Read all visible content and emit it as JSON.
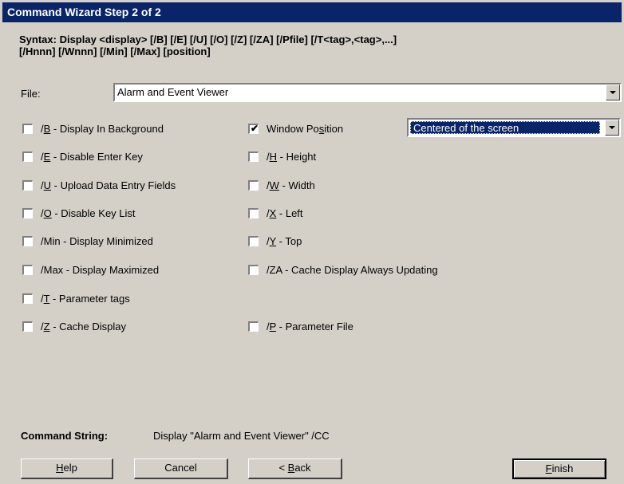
{
  "window": {
    "title": "Command Wizard Step 2 of 2"
  },
  "syntax": {
    "line1": "Syntax: Display <display> [/B] [/E] [/U] [/O] [/Z] [/ZA] [/Pfile] [/T<tag>,<tag>,...]",
    "line2": "[/Hnnn] [/Wnnn] [/Min] [/Max] [position]"
  },
  "file": {
    "label": "File:",
    "value": "Alarm and Event Viewer"
  },
  "position_select": {
    "value": "Centered of the screen"
  },
  "left_options": [
    {
      "prefix": "/",
      "mnemonic": "B",
      "suffix": " - Display In Background",
      "checked": false
    },
    {
      "prefix": "/",
      "mnemonic": "E",
      "suffix": " - Disable Enter Key",
      "checked": false
    },
    {
      "prefix": "/",
      "mnemonic": "U",
      "suffix": " - Upload Data Entry Fields",
      "checked": false
    },
    {
      "prefix": "/",
      "mnemonic": "O",
      "suffix": " - Disable Key List",
      "checked": false
    },
    {
      "prefix": "/Min - Display Minimized",
      "mnemonic": "",
      "suffix": "",
      "checked": false
    },
    {
      "prefix": "/Max - Display Maximized",
      "mnemonic": "",
      "suffix": "",
      "checked": false
    },
    {
      "prefix": "/",
      "mnemonic": "T",
      "suffix": " - Parameter tags",
      "checked": false
    },
    {
      "prefix": "/",
      "mnemonic": "Z",
      "suffix": " - Cache Display",
      "checked": false
    }
  ],
  "right_options": [
    {
      "prefix": "Window Po",
      "mnemonic": "s",
      "suffix": "ition",
      "checked": true
    },
    {
      "prefix": "/",
      "mnemonic": "H",
      "suffix": " - Height",
      "checked": false
    },
    {
      "prefix": "/",
      "mnemonic": "W",
      "suffix": " - Width",
      "checked": false
    },
    {
      "prefix": "/",
      "mnemonic": "X",
      "suffix": " - Left",
      "checked": false
    },
    {
      "prefix": "/",
      "mnemonic": "Y",
      "suffix": " - Top",
      "checked": false
    },
    {
      "prefix": "/ZA - Cache Display Always Updating",
      "mnemonic": "",
      "suffix": "",
      "checked": false
    },
    {
      "prefix": "/",
      "mnemonic": "P",
      "suffix": " - Parameter File",
      "checked": false
    }
  ],
  "command": {
    "label": "Command String:",
    "value": "Display \"Alarm and Event Viewer\" /CC"
  },
  "buttons": {
    "help": {
      "mnemonic": "H",
      "rest": "elp"
    },
    "cancel": {
      "label": "Cancel"
    },
    "back": {
      "prefix": "< ",
      "mnemonic": "B",
      "rest": "ack"
    },
    "finish": {
      "mnemonic": "F",
      "rest": "inish"
    }
  },
  "check_mark": "✔"
}
